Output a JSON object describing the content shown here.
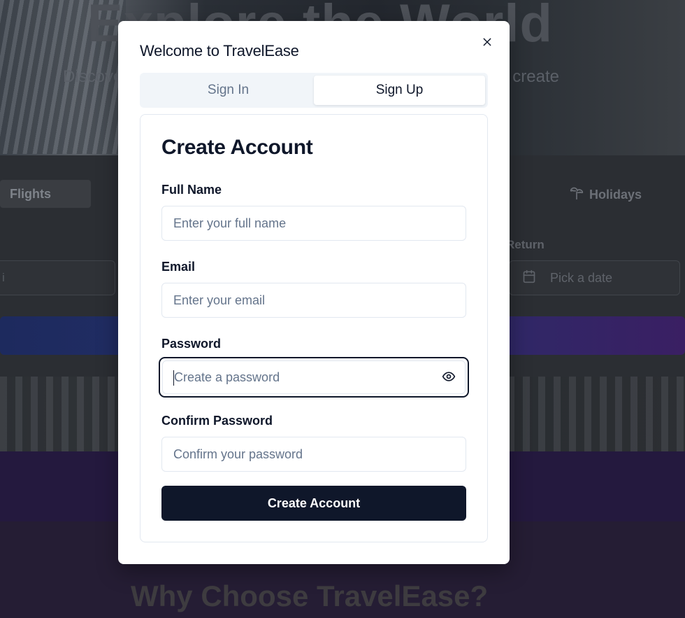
{
  "background": {
    "hero_title": "Explore the World",
    "hero_subtitle_left": "Discove",
    "hero_subtitle_right": "create",
    "tabs": {
      "flights": "Flights",
      "holidays": "Holidays"
    },
    "return_label": "Return",
    "from_value": "i",
    "return_placeholder": "Pick a date",
    "why_title": "Why Choose TravelEase?"
  },
  "modal": {
    "title": "Welcome to TravelEase",
    "tabs": [
      {
        "label": "Sign In",
        "active": false
      },
      {
        "label": "Sign Up",
        "active": true
      }
    ],
    "card_title": "Create Account",
    "fields": {
      "full_name": {
        "label": "Full Name",
        "placeholder": "Enter your full name"
      },
      "email": {
        "label": "Email",
        "placeholder": "Enter your email"
      },
      "password": {
        "label": "Password",
        "placeholder": "Create a password"
      },
      "confirm_password": {
        "label": "Confirm Password",
        "placeholder": "Confirm your password"
      }
    },
    "submit_label": "Create Account"
  },
  "colors": {
    "primary": "#0f172a",
    "muted": "#64748b",
    "border": "#e2e8f0",
    "tab_bg": "#f1f5f9"
  },
  "icons": {
    "close": "close-icon",
    "password_toggle": "eye-icon",
    "holidays": "palm-tree-icon",
    "calendar": "calendar-icon"
  }
}
